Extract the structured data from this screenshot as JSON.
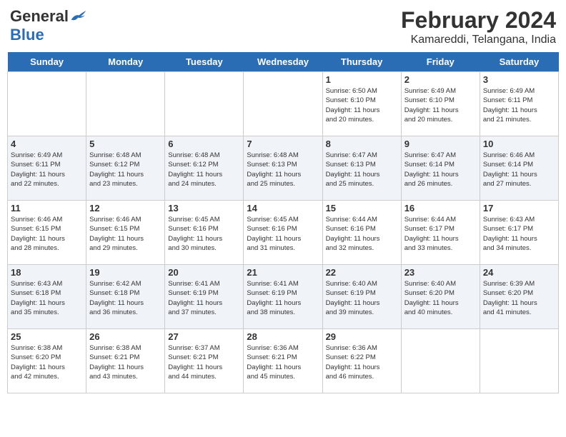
{
  "app": {
    "logo_general": "General",
    "logo_blue": "Blue"
  },
  "title": "February 2024",
  "subtitle": "Kamareddi, Telangana, India",
  "days_of_week": [
    "Sunday",
    "Monday",
    "Tuesday",
    "Wednesday",
    "Thursday",
    "Friday",
    "Saturday"
  ],
  "weeks": [
    [
      {
        "day": "",
        "info": ""
      },
      {
        "day": "",
        "info": ""
      },
      {
        "day": "",
        "info": ""
      },
      {
        "day": "",
        "info": ""
      },
      {
        "day": "1",
        "info": "Sunrise: 6:50 AM\nSunset: 6:10 PM\nDaylight: 11 hours\nand 20 minutes."
      },
      {
        "day": "2",
        "info": "Sunrise: 6:49 AM\nSunset: 6:10 PM\nDaylight: 11 hours\nand 20 minutes."
      },
      {
        "day": "3",
        "info": "Sunrise: 6:49 AM\nSunset: 6:11 PM\nDaylight: 11 hours\nand 21 minutes."
      }
    ],
    [
      {
        "day": "4",
        "info": "Sunrise: 6:49 AM\nSunset: 6:11 PM\nDaylight: 11 hours\nand 22 minutes."
      },
      {
        "day": "5",
        "info": "Sunrise: 6:48 AM\nSunset: 6:12 PM\nDaylight: 11 hours\nand 23 minutes."
      },
      {
        "day": "6",
        "info": "Sunrise: 6:48 AM\nSunset: 6:12 PM\nDaylight: 11 hours\nand 24 minutes."
      },
      {
        "day": "7",
        "info": "Sunrise: 6:48 AM\nSunset: 6:13 PM\nDaylight: 11 hours\nand 25 minutes."
      },
      {
        "day": "8",
        "info": "Sunrise: 6:47 AM\nSunset: 6:13 PM\nDaylight: 11 hours\nand 25 minutes."
      },
      {
        "day": "9",
        "info": "Sunrise: 6:47 AM\nSunset: 6:14 PM\nDaylight: 11 hours\nand 26 minutes."
      },
      {
        "day": "10",
        "info": "Sunrise: 6:46 AM\nSunset: 6:14 PM\nDaylight: 11 hours\nand 27 minutes."
      }
    ],
    [
      {
        "day": "11",
        "info": "Sunrise: 6:46 AM\nSunset: 6:15 PM\nDaylight: 11 hours\nand 28 minutes."
      },
      {
        "day": "12",
        "info": "Sunrise: 6:46 AM\nSunset: 6:15 PM\nDaylight: 11 hours\nand 29 minutes."
      },
      {
        "day": "13",
        "info": "Sunrise: 6:45 AM\nSunset: 6:16 PM\nDaylight: 11 hours\nand 30 minutes."
      },
      {
        "day": "14",
        "info": "Sunrise: 6:45 AM\nSunset: 6:16 PM\nDaylight: 11 hours\nand 31 minutes."
      },
      {
        "day": "15",
        "info": "Sunrise: 6:44 AM\nSunset: 6:16 PM\nDaylight: 11 hours\nand 32 minutes."
      },
      {
        "day": "16",
        "info": "Sunrise: 6:44 AM\nSunset: 6:17 PM\nDaylight: 11 hours\nand 33 minutes."
      },
      {
        "day": "17",
        "info": "Sunrise: 6:43 AM\nSunset: 6:17 PM\nDaylight: 11 hours\nand 34 minutes."
      }
    ],
    [
      {
        "day": "18",
        "info": "Sunrise: 6:43 AM\nSunset: 6:18 PM\nDaylight: 11 hours\nand 35 minutes."
      },
      {
        "day": "19",
        "info": "Sunrise: 6:42 AM\nSunset: 6:18 PM\nDaylight: 11 hours\nand 36 minutes."
      },
      {
        "day": "20",
        "info": "Sunrise: 6:41 AM\nSunset: 6:19 PM\nDaylight: 11 hours\nand 37 minutes."
      },
      {
        "day": "21",
        "info": "Sunrise: 6:41 AM\nSunset: 6:19 PM\nDaylight: 11 hours\nand 38 minutes."
      },
      {
        "day": "22",
        "info": "Sunrise: 6:40 AM\nSunset: 6:19 PM\nDaylight: 11 hours\nand 39 minutes."
      },
      {
        "day": "23",
        "info": "Sunrise: 6:40 AM\nSunset: 6:20 PM\nDaylight: 11 hours\nand 40 minutes."
      },
      {
        "day": "24",
        "info": "Sunrise: 6:39 AM\nSunset: 6:20 PM\nDaylight: 11 hours\nand 41 minutes."
      }
    ],
    [
      {
        "day": "25",
        "info": "Sunrise: 6:38 AM\nSunset: 6:20 PM\nDaylight: 11 hours\nand 42 minutes."
      },
      {
        "day": "26",
        "info": "Sunrise: 6:38 AM\nSunset: 6:21 PM\nDaylight: 11 hours\nand 43 minutes."
      },
      {
        "day": "27",
        "info": "Sunrise: 6:37 AM\nSunset: 6:21 PM\nDaylight: 11 hours\nand 44 minutes."
      },
      {
        "day": "28",
        "info": "Sunrise: 6:36 AM\nSunset: 6:21 PM\nDaylight: 11 hours\nand 45 minutes."
      },
      {
        "day": "29",
        "info": "Sunrise: 6:36 AM\nSunset: 6:22 PM\nDaylight: 11 hours\nand 46 minutes."
      },
      {
        "day": "",
        "info": ""
      },
      {
        "day": "",
        "info": ""
      }
    ]
  ]
}
